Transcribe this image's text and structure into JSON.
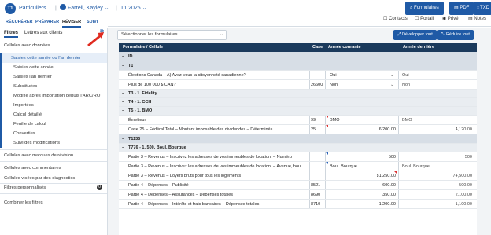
{
  "header": {
    "logo": "T1",
    "breadcrumb_1": "Particuliers",
    "breadcrumb_2": "Farrell, Kayley",
    "breadcrumb_3": "T1 2025",
    "btn_formulaires": "Formulaires",
    "btn_pdf": "PDF",
    "btn_txd": "TXD"
  },
  "toolbar": {
    "contacts": "Contacts",
    "portail": "Portail",
    "prive": "Privé",
    "notes": "Notes"
  },
  "tabs": [
    "RÉCUPÉRER",
    "PRÉPARER",
    "RÉVISER",
    "SUIVI"
  ],
  "sidebar": {
    "tab_filtres": "Filtres",
    "tab_lettres": "Lettres aux clients",
    "group_donnees": "Cellules avec données",
    "items": [
      "Saisies cette année ou l'an dernier",
      "Saisies cette année",
      "Saisies l'an dernier",
      "Substituées",
      "Modifié après importation depuis l'ARC/RQ",
      "Importées",
      "Calcul détaillé",
      "Feuille de calcul",
      "Converties",
      "Suivi des modifications"
    ],
    "group_revision": "Cellules avec marques de révision",
    "group_commentaires": "Cellules avec commentaires",
    "group_diagnostics": "Cellules visées par des diagnostics",
    "group_filtres": "Filtres personnalisés",
    "filtres_count": "0",
    "combine": "Combiner les filtres"
  },
  "main": {
    "select_placeholder": "Sélectionner les formulaires",
    "btn_develop": "Développer tout",
    "btn_reduce": "Réduire tout",
    "col_form": "Formulaire / Cellule",
    "col_case": "Case",
    "col_current": "Année courante",
    "col_previous": "Année dernière"
  },
  "rows": [
    {
      "type": "sect",
      "label": "ID"
    },
    {
      "type": "sect",
      "label": "T1"
    },
    {
      "type": "data",
      "label": "Élections Canada – A) Avez-vous la citoyenneté canadienne?",
      "case": "",
      "current": "Oui",
      "previous": "Oui"
    },
    {
      "type": "data",
      "label": "Plus de 100 000 $ CAN?",
      "case": "26600",
      "current": "Non",
      "previous": "Non"
    },
    {
      "type": "sub",
      "label": "T3 - 1. Fidelity"
    },
    {
      "type": "sub",
      "label": "T4 - 1. CCH"
    },
    {
      "type": "sub",
      "label": "T5 - 1. BMO"
    },
    {
      "type": "data",
      "label": "Émetteur",
      "case": "99",
      "current": "BMO",
      "previous": "BMO"
    },
    {
      "type": "data",
      "label": "Case 25 – Fédéral Total – Montant imposable des dividendes – Déterminés",
      "case": "25",
      "current": "6,200.00",
      "previous": "4,120.00"
    },
    {
      "type": "sect",
      "label": "T1135"
    },
    {
      "type": "sub",
      "label": "T776 - 1. 500, Boul. Bourque"
    },
    {
      "type": "data",
      "label": "Partie 3 – Revenus – Inscrivez les adresses de vos immeubles de location. – Numéro",
      "case": "",
      "current": "500",
      "previous": "500"
    },
    {
      "type": "data",
      "label": "Partie 3 – Revenus – Inscrivez les adresses de vos immeubles de location. – Avenue, boul...",
      "case": "",
      "current": "Boul. Bourque",
      "previous": "Boul. Bourque"
    },
    {
      "type": "data",
      "label": "Partie 3 – Revenus – Loyers bruts pour tous les logements",
      "case": "",
      "current": "81,250.00",
      "previous": "74,500.00"
    },
    {
      "type": "data",
      "label": "Partie 4 – Dépenses – Publicité",
      "case": "8521",
      "current": "600.00",
      "previous": "500.00"
    },
    {
      "type": "data",
      "label": "Partie 4 – Dépenses – Assurances – Dépenses totales",
      "case": "8690",
      "current": "350.00",
      "previous": "2,100.00"
    },
    {
      "type": "data",
      "label": "Partie 4 – Dépenses – Intérêts et frais bancaires – Dépenses totales",
      "case": "8710",
      "current": "1,200.00",
      "previous": "1,100.00"
    }
  ]
}
